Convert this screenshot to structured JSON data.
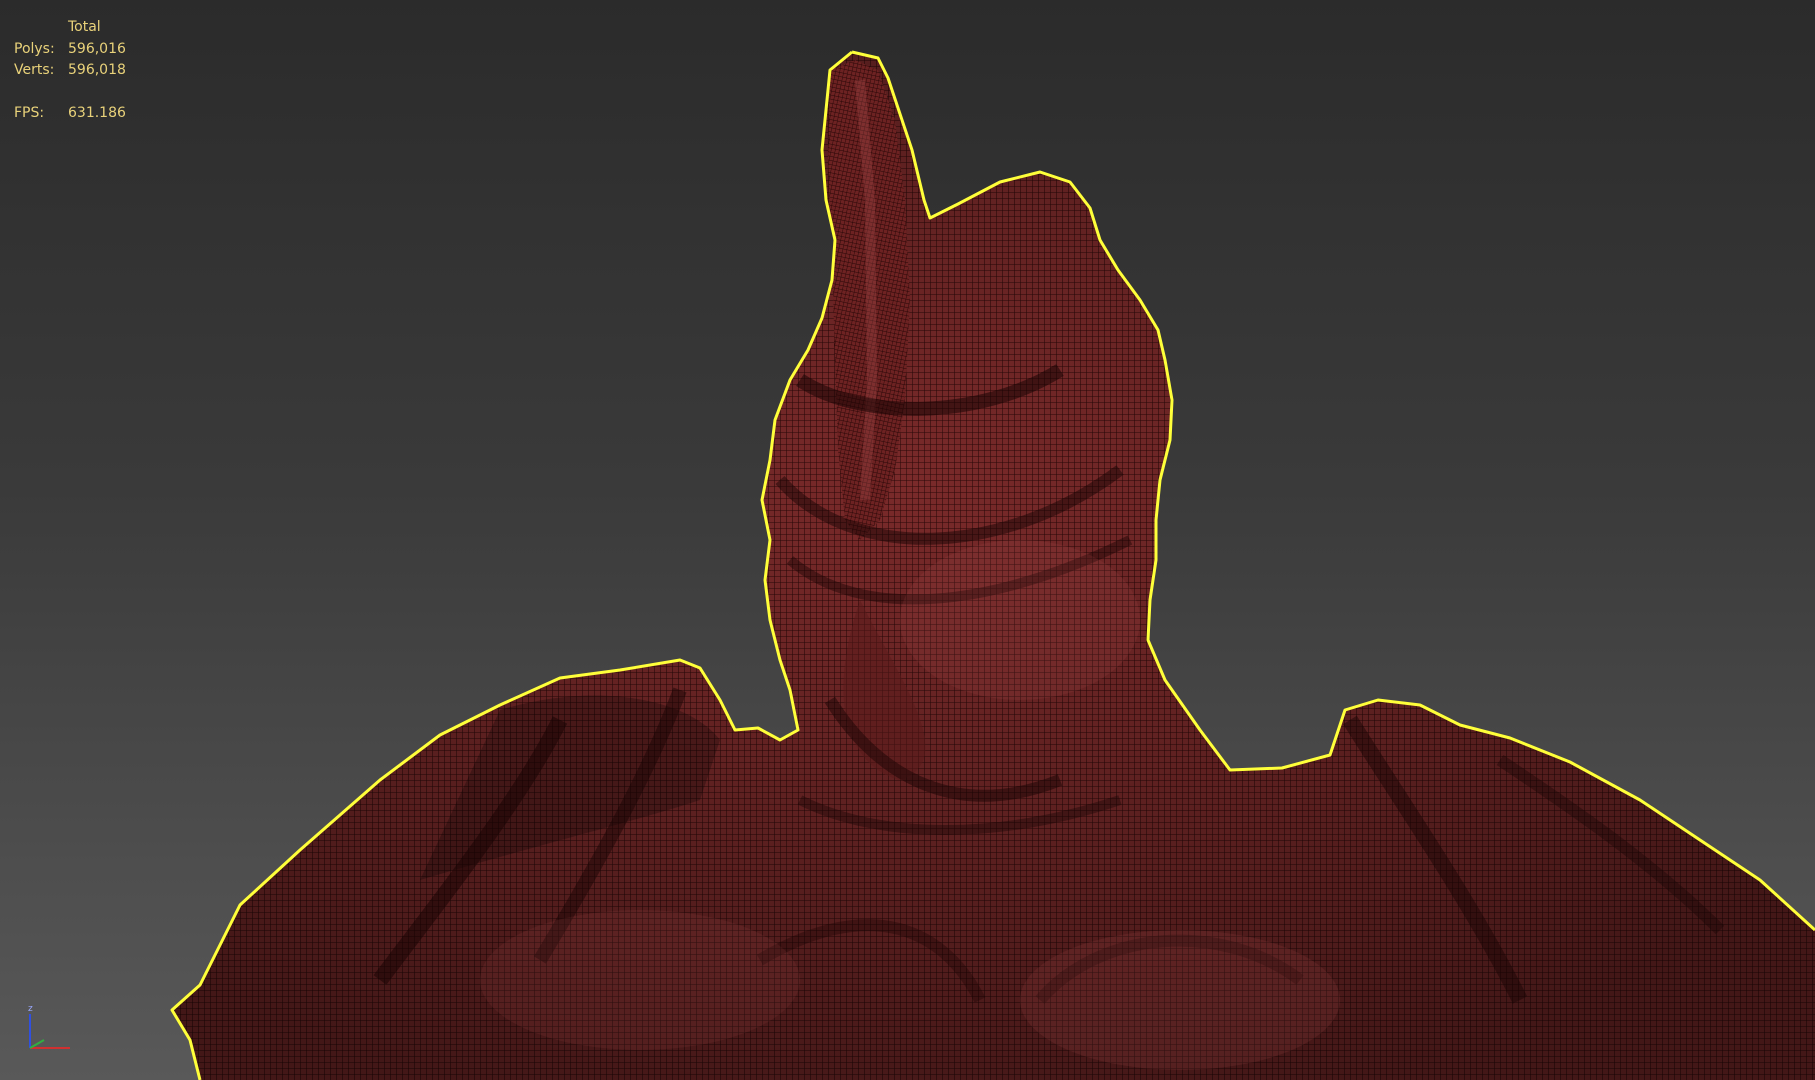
{
  "viewport": {
    "stats": {
      "header": "Total",
      "polys_label": "Polys:",
      "polys_value": "596,016",
      "verts_label": "Verts:",
      "verts_value": "596,018",
      "fps_label": "FPS:",
      "fps_value": "631.186"
    },
    "gizmo": {
      "z_label": "z"
    },
    "colors": {
      "background_top": "#2b2b2b",
      "background_bottom": "#595959",
      "stats_text": "#e9d27a",
      "mesh_fill": "#6b2424",
      "wire": "#2a0808",
      "selection_outline": "#ffff3a",
      "axis_x": "#d03030",
      "axis_y": "#30b040",
      "axis_z": "#3050e0"
    },
    "model": {
      "icon": "creature-bust-mesh",
      "selected": true,
      "display": "wireframe-on-shaded"
    }
  }
}
